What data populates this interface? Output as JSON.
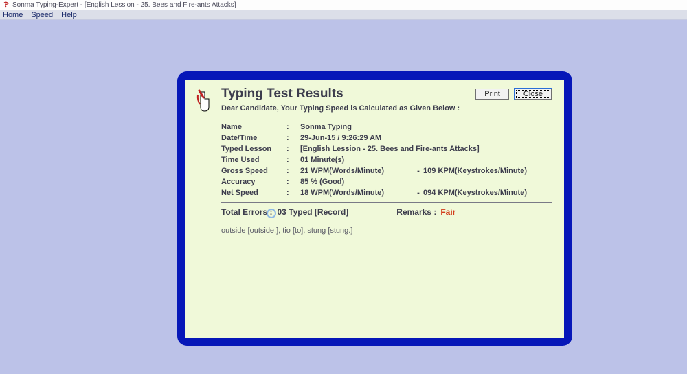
{
  "window": {
    "title": "Sonma Typing-Expert - [English Lession - 25. Bees and Fire-ants Attacks]"
  },
  "menu": {
    "home": "Home",
    "speed": "Speed",
    "help": "Help"
  },
  "dialog": {
    "title": "Typing Test Results",
    "print": "Print",
    "close": "Close",
    "subtitle": "Dear Candidate, Your Typing Speed is Calculated as Given Below :",
    "rows": {
      "name_lbl": "Name",
      "name_val": "Sonma Typing",
      "date_lbl": "Date/Time",
      "date_val": "29-Jun-15 / 9:26:29 AM",
      "lesson_lbl": "Typed Lesson",
      "lesson_val": "[English Lession - 25. Bees and Fire-ants Attacks]",
      "time_lbl": "Time Used",
      "time_val": "01 Minute(s)",
      "gross_lbl": "Gross Speed",
      "gross_wpm": "21 WPM(Words/Minute)",
      "gross_kpm": "109 KPM(Keystrokes/Minute)",
      "acc_lbl": "Accuracy",
      "acc_val": "85 % (Good)",
      "net_lbl": "Net Speed",
      "net_wpm": "18 WPM(Words/Minute)",
      "net_kpm": "094 KPM(Keystrokes/Minute)",
      "dash": "-"
    },
    "totals": {
      "errors_lbl": "Total Errors  :",
      "errors_val": "03 Typed [Record]",
      "remarks_lbl": "Remarks  :",
      "remarks_val": "Fair"
    },
    "errors_text": "outside [outside,], tio [to], stung [stung.]"
  }
}
